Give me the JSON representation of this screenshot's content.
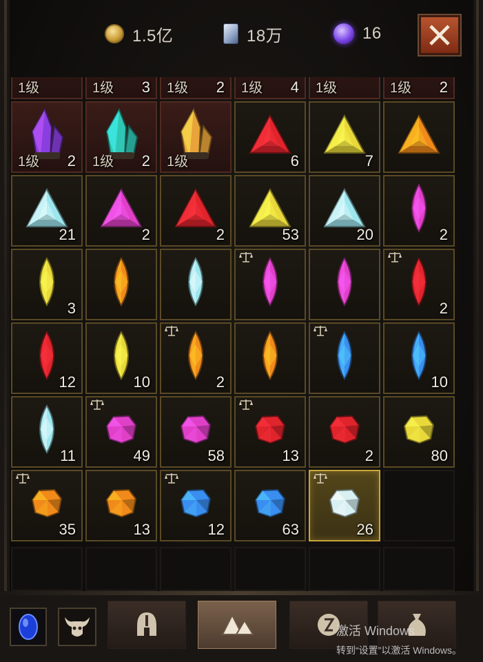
{
  "currency": {
    "gold": "1.5亿",
    "scroll": "18万",
    "orb": "16"
  },
  "icons": {
    "gold": "coin-icon",
    "scroll": "scroll-icon",
    "orb": "purple-orb-icon",
    "close": "close-icon",
    "locked": "scale-icon"
  },
  "grid": {
    "partial_row": [
      {
        "level": "1级",
        "qty": ""
      },
      {
        "level": "1级",
        "qty": "3"
      },
      {
        "level": "1级",
        "qty": "2"
      },
      {
        "level": "1级",
        "qty": "4"
      },
      {
        "level": "1级",
        "qty": ""
      },
      {
        "level": "1级",
        "qty": "2"
      }
    ],
    "rows": [
      [
        {
          "gem": "purple-crystal",
          "level": "1级",
          "qty": "2"
        },
        {
          "gem": "teal-crystal",
          "level": "1级",
          "qty": "2"
        },
        {
          "gem": "amber-crystal",
          "level": "1级",
          "qty": ""
        },
        {
          "gem": "red-triangle",
          "qty": "6"
        },
        {
          "gem": "yellow-triangle",
          "qty": "7"
        },
        {
          "gem": "orange-triangle",
          "qty": ""
        }
      ],
      [
        {
          "gem": "cyan-triangle",
          "qty": "21"
        },
        {
          "gem": "magenta-triangle",
          "qty": "2"
        },
        {
          "gem": "red-triangle",
          "qty": "2"
        },
        {
          "gem": "yellow-triangle",
          "qty": "53"
        },
        {
          "gem": "cyan-triangle",
          "qty": "20"
        },
        {
          "gem": "magenta-marquise",
          "qty": "2"
        }
      ],
      [
        {
          "gem": "yellow-marquise",
          "qty": "3"
        },
        {
          "gem": "orange-marquise",
          "qty": ""
        },
        {
          "gem": "cyan-marquise",
          "qty": ""
        },
        {
          "gem": "magenta-marquise",
          "qty": "",
          "locked": true
        },
        {
          "gem": "magenta-marquise",
          "qty": ""
        },
        {
          "gem": "red-marquise",
          "qty": "2",
          "locked": true
        }
      ],
      [
        {
          "gem": "red-marquise",
          "qty": "12"
        },
        {
          "gem": "yellow-marquise",
          "qty": "10"
        },
        {
          "gem": "orange-marquise",
          "qty": "2",
          "locked": true
        },
        {
          "gem": "orange-marquise",
          "qty": ""
        },
        {
          "gem": "blue-marquise",
          "qty": "",
          "locked": true
        },
        {
          "gem": "blue-marquise",
          "qty": "10"
        }
      ],
      [
        {
          "gem": "cyan-marquise",
          "qty": "11"
        },
        {
          "gem": "magenta-rough",
          "qty": "49",
          "locked": true
        },
        {
          "gem": "magenta-rough",
          "qty": "58"
        },
        {
          "gem": "red-rough",
          "qty": "13",
          "locked": true
        },
        {
          "gem": "red-rough",
          "qty": "2"
        },
        {
          "gem": "yellow-rough",
          "qty": "80"
        }
      ],
      [
        {
          "gem": "orange-rough",
          "qty": "35",
          "locked": true
        },
        {
          "gem": "orange-rough",
          "qty": "13"
        },
        {
          "gem": "blue-rough",
          "qty": "12",
          "locked": true
        },
        {
          "gem": "blue-rough",
          "qty": "63"
        },
        {
          "gem": "white-rough",
          "qty": "26",
          "locked": true,
          "selected": true
        },
        {
          "gem": "",
          "qty": "",
          "empty": true
        }
      ]
    ]
  },
  "gem_colors": {
    "purple": "#8a3ee0",
    "teal": "#2fc7b4",
    "amber": "#e8a43a",
    "red": "#e0242c",
    "yellow": "#e8d83a",
    "orange": "#f08a1a",
    "cyan": "#9ee6ee",
    "magenta": "#e040c8",
    "blue": "#3a8ef0",
    "white": "#d8f0f2"
  },
  "footer": {
    "buttons": [
      "blue-orb-icon",
      "bull-skull-icon"
    ],
    "tabs": [
      "helmet-icon",
      "gems-icon",
      "rune-icon",
      "pouch-icon"
    ],
    "active_tab": "gems-icon"
  },
  "watermark": {
    "line1": "激活 Windows",
    "line2": "转到“设置”以激活 Windows。"
  }
}
